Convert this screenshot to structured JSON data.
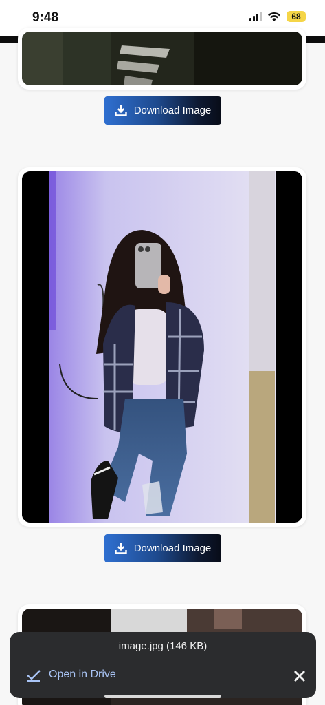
{
  "status_bar": {
    "time": "9:48",
    "battery": "68",
    "icons": [
      "cellular-signal-icon",
      "wifi-icon",
      "battery-icon"
    ]
  },
  "images": [
    {
      "description_icon": "photo-icon",
      "download_label": "Download Image"
    },
    {
      "description_icon": "photo-icon",
      "download_label": "Download Image"
    },
    {
      "description_icon": "photo-icon"
    }
  ],
  "snackbar": {
    "title": "image.jpg (146 KB)",
    "action_label": "Open in Drive"
  },
  "colors": {
    "button_gradient_start": "#2f6fd0",
    "button_gradient_end": "#080c18",
    "snackbar_bg": "#2b2c2e",
    "snackbar_action": "#a9c4f5",
    "battery": "#f5d547"
  }
}
